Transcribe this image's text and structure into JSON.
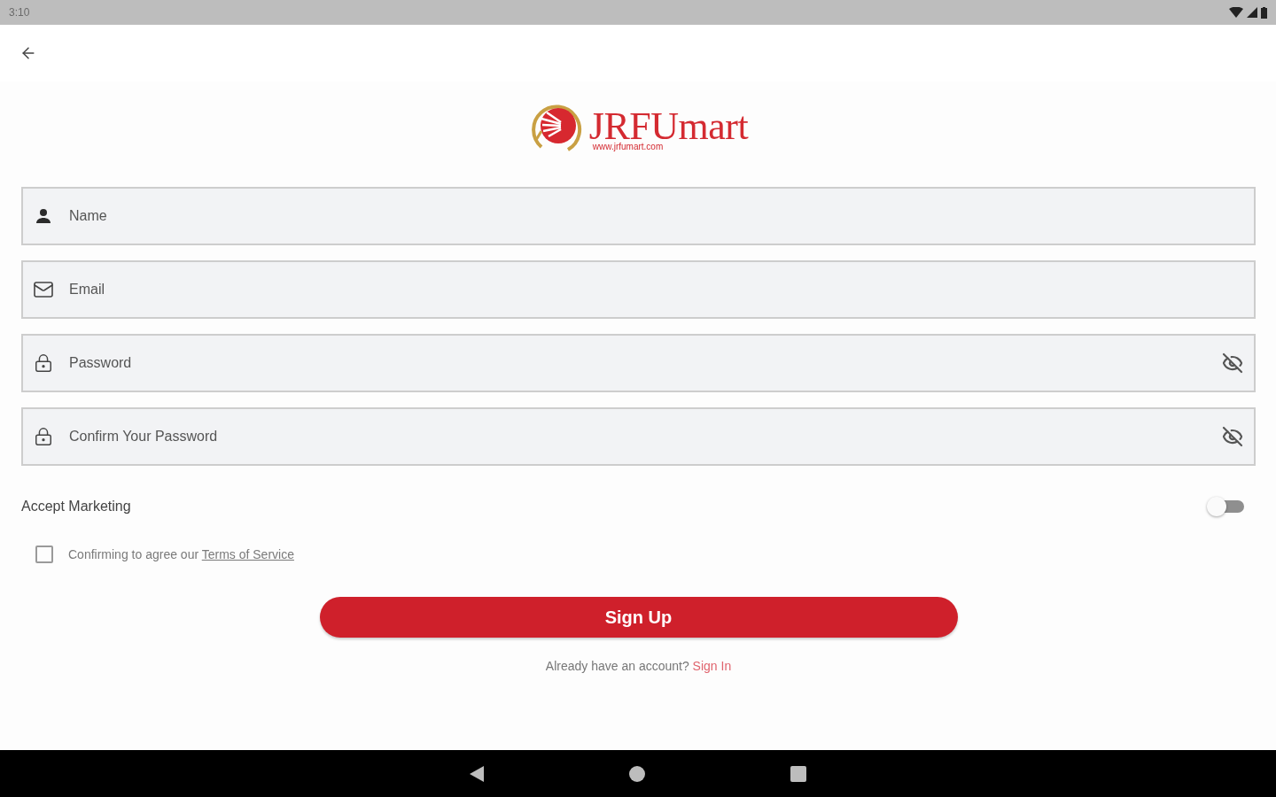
{
  "status_bar": {
    "time": "3:10"
  },
  "logo": {
    "name": "JRFUmart",
    "url": "www.jrfumart.com"
  },
  "fields": [
    {
      "kind": "name",
      "placeholder": "Name"
    },
    {
      "kind": "email",
      "placeholder": "Email"
    },
    {
      "kind": "password",
      "placeholder": "Password"
    },
    {
      "kind": "password",
      "placeholder": "Confirm Your Password"
    }
  ],
  "marketing": {
    "label": "Accept Marketing",
    "on": false
  },
  "terms": {
    "checked": false,
    "text": "Confirming to agree our",
    "link": "Terms of Service"
  },
  "sign_up_button": "Sign Up",
  "sign_in_prompt": {
    "text": "Already have an account?",
    "link": "Sign In"
  }
}
